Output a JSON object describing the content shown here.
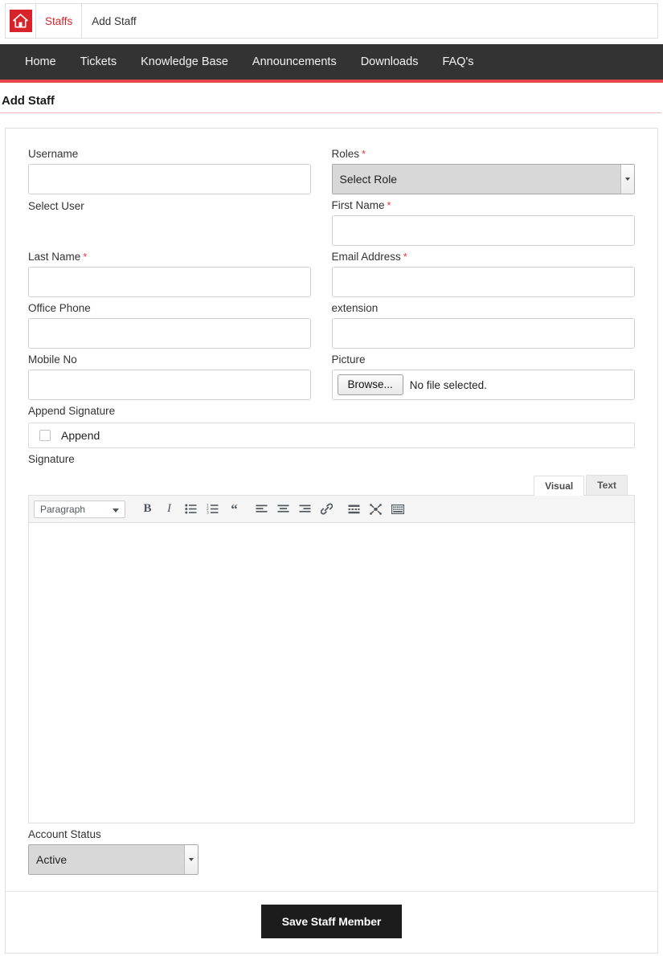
{
  "breadcrumb": {
    "home_icon": "home-icon",
    "parent_label": "Staffs",
    "current_label": "Add Staff"
  },
  "nav": {
    "items": [
      {
        "label": "Home"
      },
      {
        "label": "Tickets"
      },
      {
        "label": "Knowledge Base"
      },
      {
        "label": "Announcements"
      },
      {
        "label": "Downloads"
      },
      {
        "label": "FAQ's"
      }
    ]
  },
  "page": {
    "title": "Add Staff"
  },
  "form": {
    "username": {
      "label": "Username",
      "value": "",
      "placeholder": "",
      "helper": "Select User"
    },
    "roles": {
      "label": "Roles",
      "required_mark": "*",
      "selected": "Select Role"
    },
    "first_name": {
      "label": "First Name",
      "required_mark": "*",
      "value": "",
      "placeholder": ""
    },
    "last_name": {
      "label": "Last Name",
      "required_mark": "*",
      "value": "",
      "placeholder": ""
    },
    "email_address": {
      "label": "Email Address",
      "required_mark": "*",
      "value": "",
      "placeholder": ""
    },
    "office_phone": {
      "label": "Office Phone",
      "value": "",
      "placeholder": ""
    },
    "extension": {
      "label": "extension",
      "value": "",
      "placeholder": ""
    },
    "mobile_no": {
      "label": "Mobile No",
      "value": "",
      "placeholder": ""
    },
    "picture": {
      "label": "Picture",
      "browse_label": "Browse...",
      "file_status": "No file selected."
    },
    "append_signature": {
      "label": "Append Signature",
      "checkbox_label": "Append",
      "checked": false
    },
    "signature": {
      "label": "Signature"
    },
    "account_status": {
      "label": "Account Status",
      "selected": "Active"
    }
  },
  "editor": {
    "tabs": [
      {
        "label": "Visual",
        "active": true
      },
      {
        "label": "Text",
        "active": false
      }
    ],
    "format_select": "Paragraph",
    "toolbar": [
      {
        "name": "bold-icon",
        "glyph": "B"
      },
      {
        "name": "italic-icon",
        "glyph": "I"
      },
      {
        "name": "bulleted-list-icon",
        "glyph": ""
      },
      {
        "name": "numbered-list-icon",
        "glyph": ""
      },
      {
        "name": "blockquote-icon",
        "glyph": "“"
      },
      {
        "name": "align-left-icon",
        "glyph": ""
      },
      {
        "name": "align-center-icon",
        "glyph": ""
      },
      {
        "name": "align-right-icon",
        "glyph": ""
      },
      {
        "name": "insert-link-icon",
        "glyph": ""
      },
      {
        "name": "insert-read-more-icon",
        "glyph": ""
      },
      {
        "name": "fullscreen-icon",
        "glyph": ""
      },
      {
        "name": "toolbar-toggle-icon",
        "glyph": ""
      }
    ],
    "content": ""
  },
  "footer": {
    "save_label": "Save Staff Member"
  },
  "colors": {
    "brand_red": "#d8232a",
    "nav_bg": "#333333",
    "nav_accent": "#e8464d",
    "button_dark": "#1c1c1c",
    "required_red": "#e8333a"
  }
}
